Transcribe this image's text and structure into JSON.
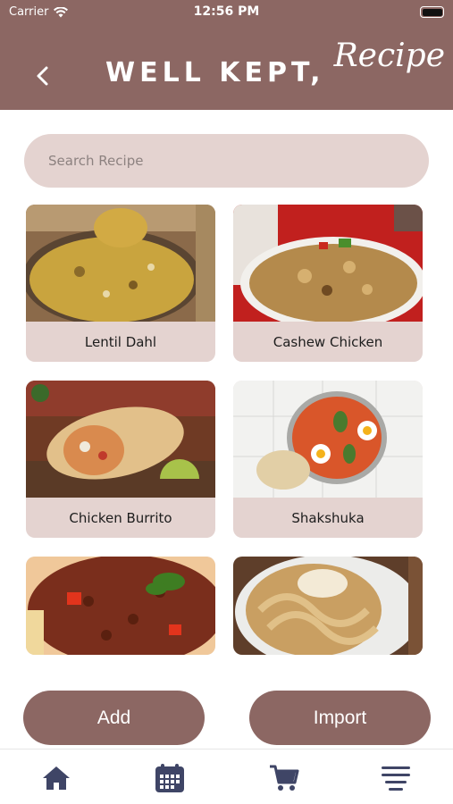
{
  "status_bar": {
    "carrier": "Carrier",
    "time": "12:56 PM"
  },
  "header": {
    "title_main": "WELL KEPT,",
    "title_script": "Recipe",
    "back_icon": "chevron-left-icon"
  },
  "search": {
    "placeholder": "Search Recipe",
    "value": ""
  },
  "recipes": [
    {
      "name": "Lentil Dahl"
    },
    {
      "name": "Cashew Chicken"
    },
    {
      "name": "Chicken Burrito"
    },
    {
      "name": "Shakshuka"
    },
    {
      "name": ""
    },
    {
      "name": ""
    }
  ],
  "actions": {
    "add_label": "Add",
    "import_label": "Import"
  },
  "tab_bar": {
    "items": [
      "home-icon",
      "calendar-icon",
      "cart-icon",
      "menu-icon"
    ]
  },
  "colors": {
    "accent": "#8c6763",
    "card_bg": "#e4d3d0",
    "tab_icon": "#3f4566"
  }
}
